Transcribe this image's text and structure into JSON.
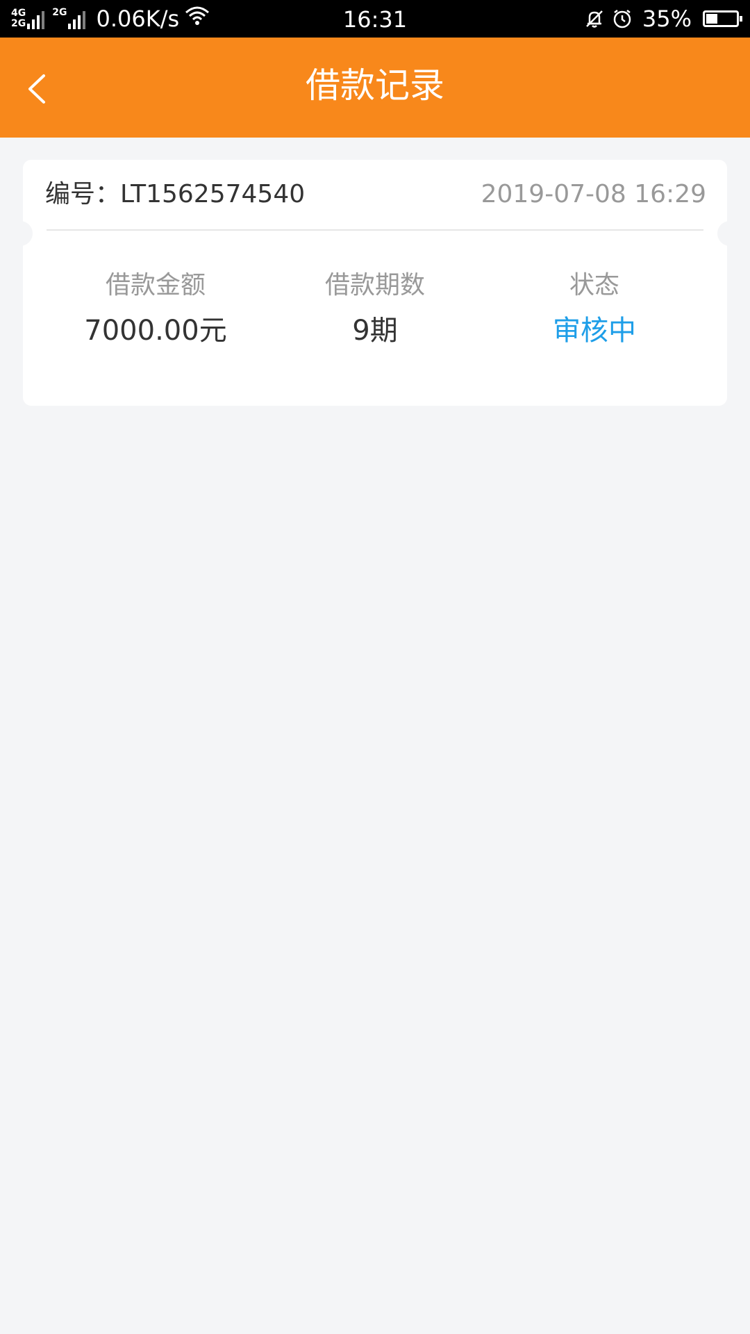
{
  "status_bar": {
    "network_top": "4G",
    "network_bottom": "2G",
    "network_secondary": "2G",
    "speed": "0.06K/s",
    "time": "16:31",
    "battery": "35%",
    "icons": [
      "signal-icon",
      "wifi-icon",
      "bell-off-icon",
      "alarm-icon",
      "battery-icon"
    ]
  },
  "header": {
    "title": "借款记录",
    "back_icon": "chevron-left-icon",
    "background_color": "#f8881b"
  },
  "record": {
    "number": "编号：LT1562574540",
    "datetime": "2019-07-08 16:29",
    "stats": [
      {
        "label": "借款金额",
        "value": "7000.00元"
      },
      {
        "label": "借款期数",
        "value": "9期"
      },
      {
        "label": "状态",
        "value": "审核中"
      }
    ],
    "status_color": "#1e9ee8"
  }
}
